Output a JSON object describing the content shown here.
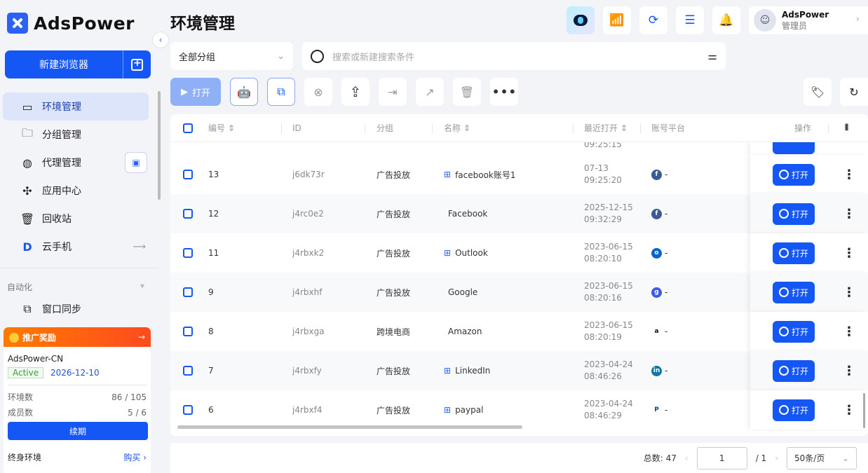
{
  "app": {
    "name": "AdsPower"
  },
  "sidebar": {
    "new_browser": "新建浏览器",
    "items": [
      {
        "label": "环境管理",
        "active": true
      },
      {
        "label": "分组管理"
      },
      {
        "label": "代理管理"
      },
      {
        "label": "应用中心"
      },
      {
        "label": "回收站"
      },
      {
        "label": "云手机"
      }
    ],
    "automation_title": "自动化",
    "window_sync": "窗口同步",
    "promo": {
      "title": "推广奖励",
      "account": "AdsPower-CN",
      "status": "Active",
      "expiry": "2026-12-10",
      "env_label": "环境数",
      "env_value": "86 / 105",
      "member_label": "成员数",
      "member_value": "5 / 6",
      "renew": "续期",
      "lifetime": "终身环境",
      "buy": "购买"
    }
  },
  "header": {
    "title": "环境管理",
    "user_name": "AdsPower",
    "user_role": "管理员"
  },
  "filter": {
    "group": "全部分组"
  },
  "search": {
    "placeholder": "搜索或新建搜索条件"
  },
  "toolbar": {
    "open": "打开"
  },
  "table": {
    "headers": {
      "no": "编号",
      "id": "ID",
      "group": "分组",
      "name": "名称",
      "last_open": "最近打开",
      "platform": "账号平台",
      "ops": "操作"
    },
    "partial_time": "09:25:15",
    "rows": [
      {
        "no": "13",
        "id": "j6dk73r",
        "group": "广告投放",
        "os": "windows",
        "name": "facebook账号1",
        "date": "07-13",
        "time": "09:25:20",
        "platform": "facebook",
        "platform_text": "-",
        "open": "打开"
      },
      {
        "no": "12",
        "id": "j4rc0e2",
        "group": "广告投放",
        "os": "apple",
        "name": "Facebook",
        "date": "2025-12-15",
        "time": "09:32:29",
        "platform": "facebook",
        "platform_text": "-",
        "open": "打开"
      },
      {
        "no": "11",
        "id": "j4rbxk2",
        "group": "广告投放",
        "os": "windows",
        "name": "Outlook",
        "date": "2023-06-15",
        "time": "08:20:10",
        "platform": "outlook",
        "platform_text": "-",
        "open": "打开"
      },
      {
        "no": "9",
        "id": "j4rbxhf",
        "group": "广告投放",
        "os": "apple",
        "name": "Google",
        "date": "2023-06-15",
        "time": "08:20:16",
        "platform": "google",
        "platform_text": "-",
        "open": "打开"
      },
      {
        "no": "8",
        "id": "j4rbxga",
        "group": "跨境电商",
        "os": "apple",
        "name": "Amazon",
        "date": "2023-06-15",
        "time": "08:20:19",
        "platform": "amazon",
        "platform_text": "-",
        "open": "打开"
      },
      {
        "no": "7",
        "id": "j4rbxfy",
        "group": "广告投放",
        "os": "windows",
        "name": "LinkedIn",
        "date": "2023-04-24",
        "time": "08:46:26",
        "platform": "linkedin",
        "platform_text": "-",
        "open": "打开"
      },
      {
        "no": "6",
        "id": "j4rbxf4",
        "group": "广告投放",
        "os": "windows",
        "name": "paypal",
        "date": "2023-04-24",
        "time": "08:46:29",
        "platform": "paypal",
        "platform_text": "-",
        "open": "打开"
      }
    ]
  },
  "pager": {
    "total": "总数: 47",
    "page": "1",
    "pages": "/ 1",
    "page_size": "50条/页"
  }
}
